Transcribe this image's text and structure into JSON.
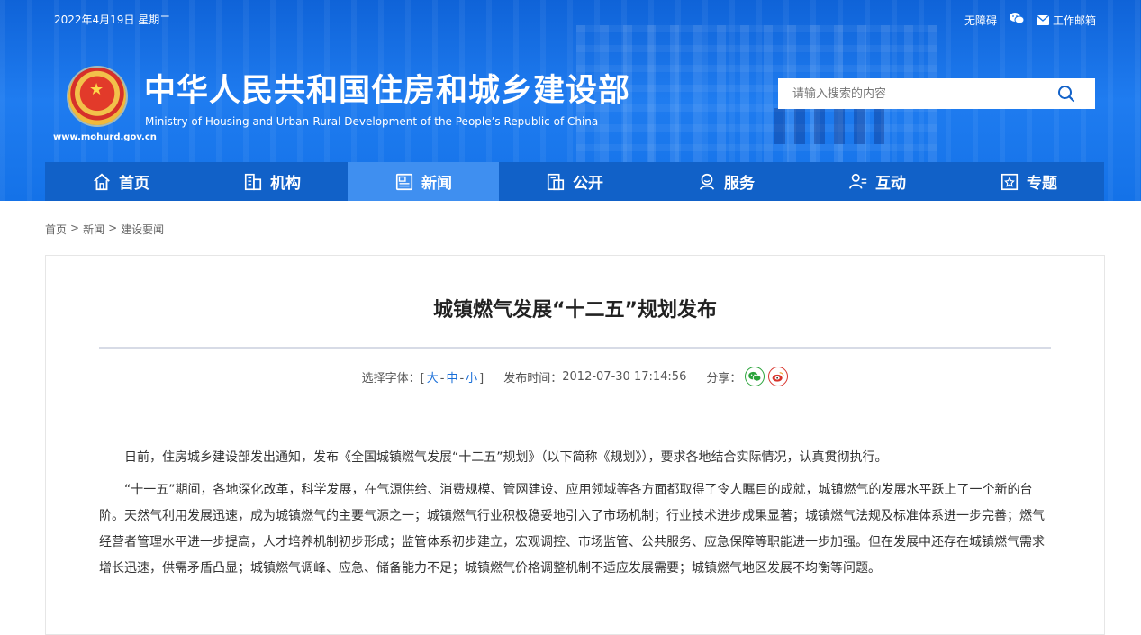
{
  "topbar": {
    "date": "2022年4月19日 星期二",
    "accessibility": "无障碍",
    "wechat_icon": "wechat-icon",
    "mail_label": "工作邮箱"
  },
  "header": {
    "site_name": "中华人民共和国住房和城乡建设部",
    "site_name_en": "Ministry of Housing and Urban-Rural Development of the People’s Republic of China",
    "site_url": "www.mohurd.gov.cn"
  },
  "search": {
    "placeholder": "请输入搜索的内容",
    "value": ""
  },
  "nav": {
    "items": [
      {
        "label": "首页",
        "icon": "home-icon"
      },
      {
        "label": "机构",
        "icon": "building-icon"
      },
      {
        "label": "新闻",
        "icon": "news-icon",
        "active": true
      },
      {
        "label": "公开",
        "icon": "disclosure-icon"
      },
      {
        "label": "服务",
        "icon": "service-icon"
      },
      {
        "label": "互动",
        "icon": "interact-icon"
      },
      {
        "label": "专题",
        "icon": "topic-icon"
      }
    ]
  },
  "breadcrumb": {
    "items": [
      "首页",
      "新闻",
      "建设要闻"
    ],
    "separator": ">"
  },
  "article": {
    "title": "城镇燃气发展“十二五”规划发布",
    "font_label": "选择字体：[",
    "font_large": "大",
    "font_medium": "中",
    "font_small": "小",
    "font_close": "]",
    "font_sep": "-",
    "publish_label": "发布时间：",
    "publish_time": "2012-07-30 17:14:56",
    "share_label": "分享：",
    "paragraphs": [
      "日前，住房城乡建设部发出通知，发布《全国城镇燃气发展“十二五”规划》（以下简称《规划》），要求各地结合实际情况，认真贯彻执行。",
      "“十一五”期间，各地深化改革，科学发展，在气源供给、消费规模、管网建设、应用领域等各方面都取得了令人瞩目的成就，城镇燃气的发展水平跃上了一个新的台阶。天然气利用发展迅速，成为城镇燃气的主要气源之一；城镇燃气行业积极稳妥地引入了市场机制；行业技术进步成果显著；城镇燃气法规及标准体系进一步完善；燃气经营者管理水平进一步提高，人才培养机制初步形成；监管体系初步建立，宏观调控、市场监管、公共服务、应急保障等职能进一步加强。但在发展中还存在城镇燃气需求增长迅速，供需矛盾凸显；城镇燃气调峰、应急、储备能力不足；城镇燃气价格调整机制不适应发展需要；城镇燃气地区发展不均衡等问题。"
    ]
  },
  "colors": {
    "header_blue": "#1472e8",
    "nav_blue": "#1161c8",
    "nav_active": "#3f8ff0",
    "link_blue": "#1a6fd8"
  }
}
